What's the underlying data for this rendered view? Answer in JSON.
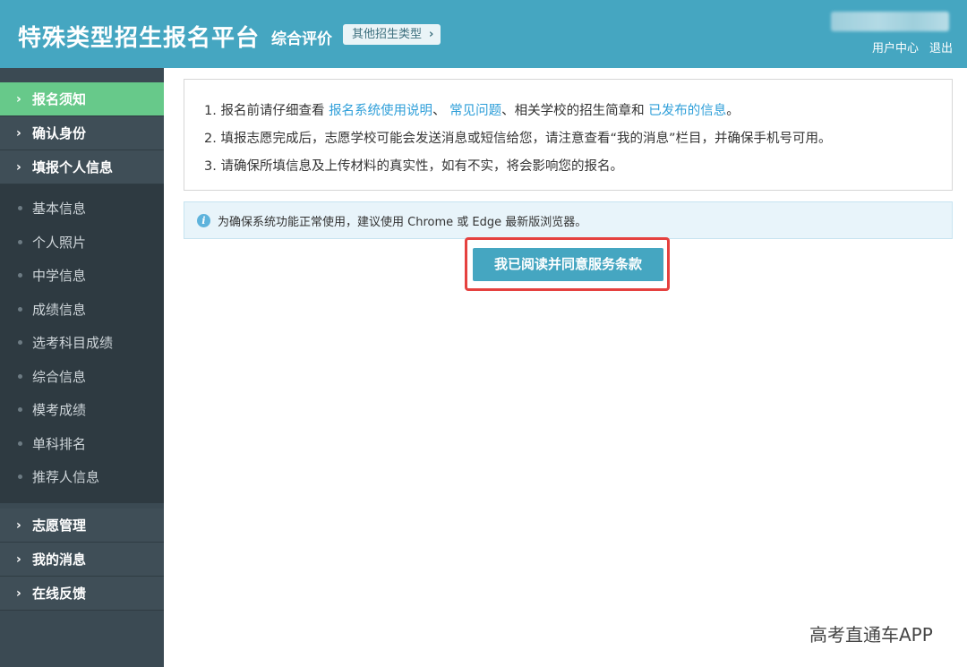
{
  "header": {
    "app_title": "特殊类型招生报名平台",
    "subtitle": "综合评价",
    "other_types_label": "其他招生类型",
    "user_center": "用户中心",
    "logout": "退出"
  },
  "sidebar": {
    "top_items": [
      {
        "label": "报名须知",
        "active": true
      },
      {
        "label": "确认身份"
      },
      {
        "label": "填报个人信息"
      }
    ],
    "sub_items": [
      "基本信息",
      "个人照片",
      "中学信息",
      "成绩信息",
      "选考科目成绩",
      "综合信息",
      "模考成绩",
      "单科排名",
      "推荐人信息"
    ],
    "bottom_items": [
      {
        "label": "志愿管理"
      },
      {
        "label": "我的消息"
      },
      {
        "label": "在线反馈"
      }
    ]
  },
  "notice": {
    "line1_a": "1. 报名前请仔细查看 ",
    "link_manual": "报名系统使用说明",
    "line1_sep": "、 ",
    "link_faq": "常见问题",
    "line1_b": "、相关学校的招生简章和 ",
    "link_published": "已发布的信息",
    "line1_end": "。",
    "line2": "2. 填报志愿完成后，志愿学校可能会发送消息或短信给您，请注意查看“我的消息”栏目，并确保手机号可用。",
    "line3": "3. 请确保所填信息及上传材料的真实性，如有不实，将会影响您的报名。"
  },
  "tip": {
    "icon": "info-icon",
    "text": "为确保系统功能正常使用，建议使用 Chrome 或 Edge 最新版浏览器。"
  },
  "agree_button": "我已阅读并同意服务条款",
  "watermark": "高考直通车APP",
  "colors": {
    "header_bg": "#45a6c1",
    "sidebar_bg": "#3b4a53",
    "active_bg": "#67c98a",
    "link": "#2f9fd9",
    "highlight": "#e5413f"
  }
}
